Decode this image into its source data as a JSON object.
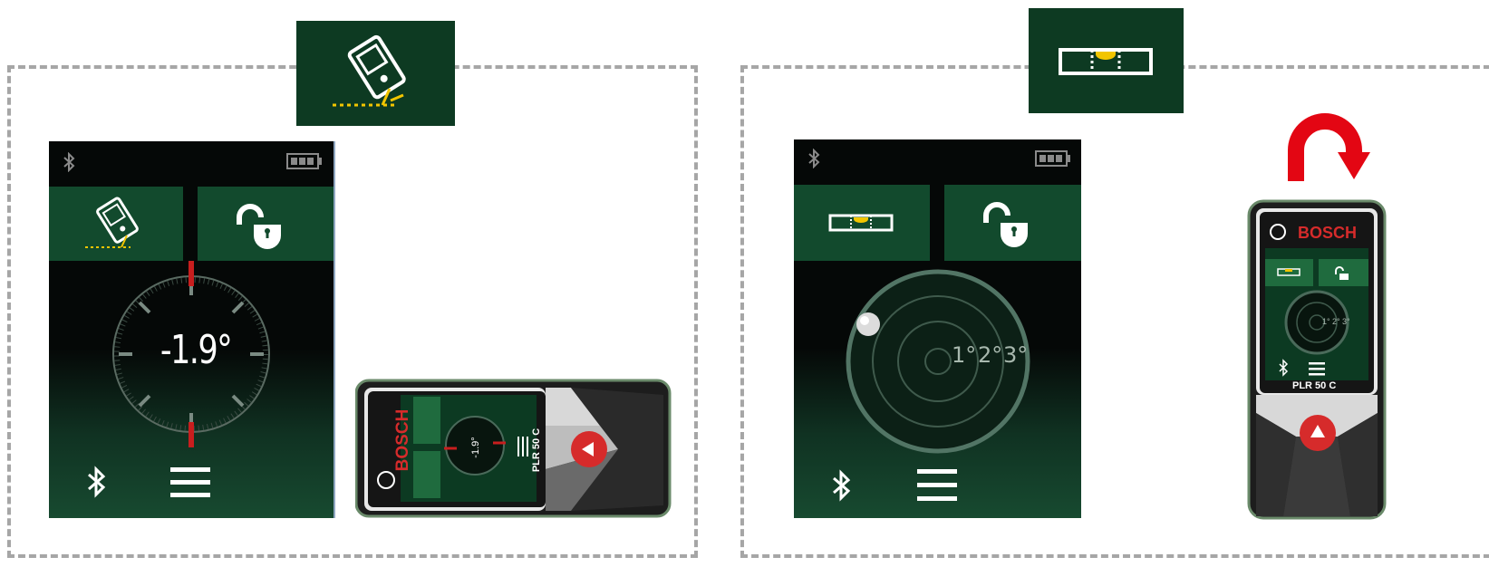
{
  "left_panel": {
    "mode": "tilt-measurement",
    "readout": "-1.9°",
    "tiles": [
      "tilt-mode-icon",
      "unlock-icon"
    ],
    "bottom_icons": [
      "bluetooth-icon",
      "menu-icon"
    ]
  },
  "left_device": {
    "brand": "BOSCH",
    "model": "PLR 50 C",
    "screen_readout": "-1.9°",
    "orientation": "horizontal"
  },
  "right_panel": {
    "mode": "level-measurement",
    "scale_labels": [
      "1°",
      "2°",
      "3°"
    ],
    "tiles": [
      "spirit-level-icon",
      "unlock-icon"
    ],
    "bottom_icons": [
      "bluetooth-icon",
      "menu-icon"
    ]
  },
  "right_device": {
    "brand": "BOSCH",
    "model": "PLR 50 C",
    "screen_scale_labels": [
      "1°",
      "2°",
      "3°"
    ],
    "orientation": "vertical",
    "rotation_arrow_color": "#e30613"
  },
  "colors": {
    "badge": "#0d3a22",
    "tile": "#124a2d",
    "highlight": "#f2c500",
    "indicator": "#c81e1e",
    "dashed_border": "#a6a6a6"
  }
}
